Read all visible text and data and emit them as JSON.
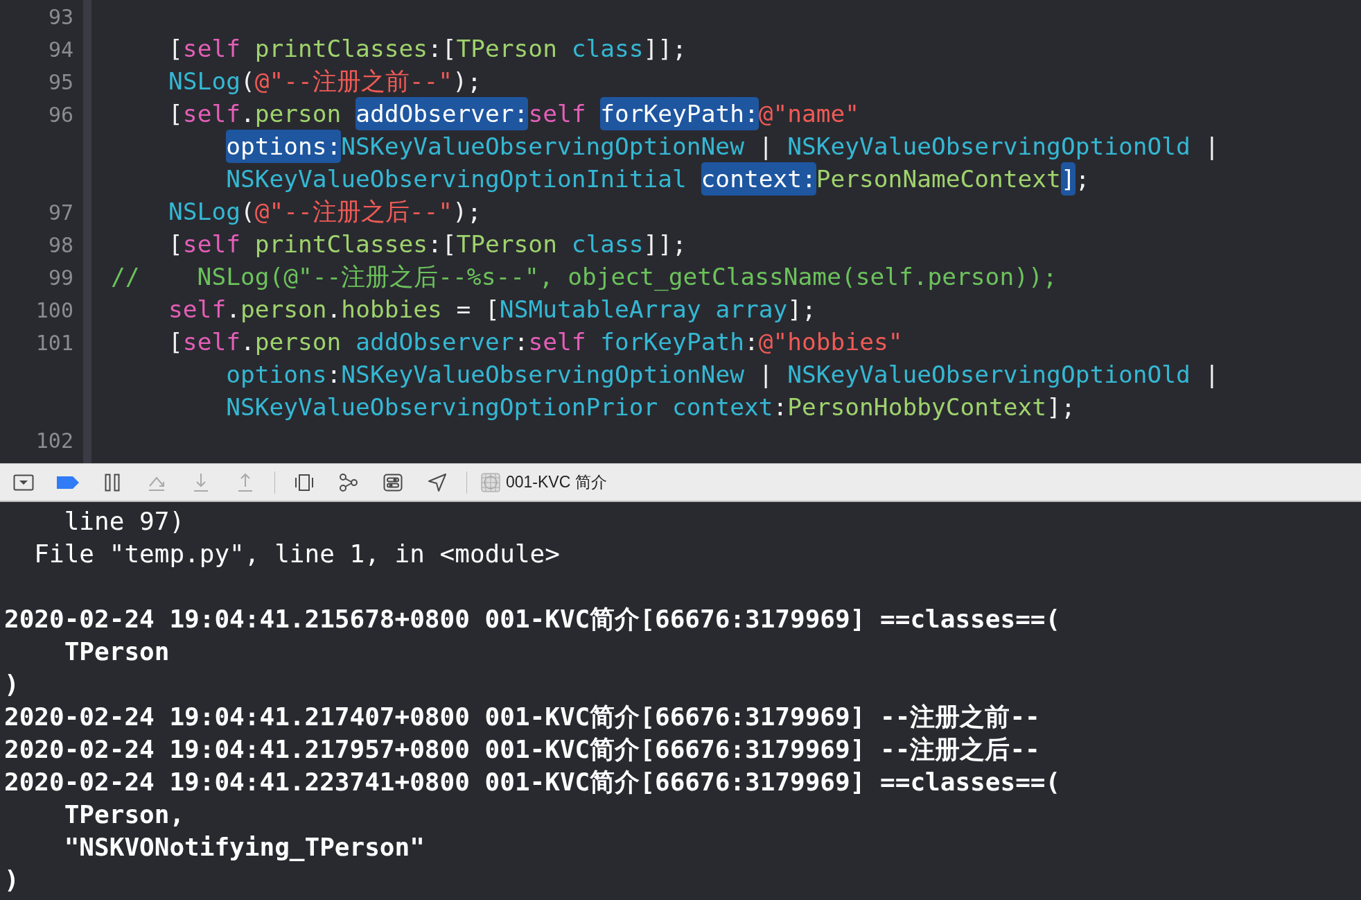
{
  "editor": {
    "lines": [
      {
        "number": "93",
        "kind": "statement"
      },
      {
        "number": "94",
        "kind": "statement",
        "tokens": [
          {
            "text": "[",
            "kind": "plain"
          },
          {
            "text": "self ",
            "kind": "keyword"
          },
          {
            "text": "printClasses",
            "kind": "project"
          },
          {
            "text": ":[",
            "kind": "plain"
          },
          {
            "text": "TPerson ",
            "kind": "project"
          },
          {
            "text": "class",
            "kind": "system"
          },
          {
            "text": "]];",
            "kind": "plain"
          }
        ]
      },
      {
        "number": "95",
        "kind": "statement",
        "tokens": [
          {
            "text": "NSLog",
            "kind": "system"
          },
          {
            "text": "(",
            "kind": "plain"
          },
          {
            "text": "@\"--注册之前--\"",
            "kind": "string"
          },
          {
            "text": ");",
            "kind": "plain"
          }
        ]
      },
      {
        "number": "96",
        "kind": "statement",
        "tokens": [
          {
            "text": "[",
            "kind": "plain"
          },
          {
            "text": "self",
            "kind": "keyword"
          },
          {
            "text": ".",
            "kind": "plain"
          },
          {
            "text": "person ",
            "kind": "project"
          },
          {
            "text": "addObserver:",
            "kind": "highlight"
          },
          {
            "text": "self ",
            "kind": "keyword"
          },
          {
            "text": "forKeyPath:",
            "kind": "highlight"
          },
          {
            "text": "@\"name\"",
            "kind": "string"
          }
        ]
      },
      {
        "kind": "continuation",
        "tokens": [
          {
            "text": "options:",
            "kind": "highlight"
          },
          {
            "text": "NSKeyValueObservingOptionNew",
            "kind": "system"
          },
          {
            "text": " | ",
            "kind": "plain"
          },
          {
            "text": "NSKeyValueObservingOptionOld",
            "kind": "system"
          },
          {
            "text": " |",
            "kind": "plain"
          }
        ]
      },
      {
        "kind": "continuation",
        "tokens": [
          {
            "text": "NSKeyValueObservingOptionInitial ",
            "kind": "system"
          },
          {
            "text": "context:",
            "kind": "highlight"
          },
          {
            "text": "PersonNameContext",
            "kind": "project"
          },
          {
            "text": "]",
            "kind": "highlight"
          },
          {
            "text": ";",
            "kind": "plain"
          }
        ]
      },
      {
        "number": "97",
        "kind": "statement",
        "tokens": [
          {
            "text": "NSLog",
            "kind": "system"
          },
          {
            "text": "(",
            "kind": "plain"
          },
          {
            "text": "@\"--注册之后--\"",
            "kind": "string"
          },
          {
            "text": ");",
            "kind": "plain"
          }
        ]
      },
      {
        "number": "98",
        "kind": "statement",
        "tokens": [
          {
            "text": "[",
            "kind": "plain"
          },
          {
            "text": "self ",
            "kind": "keyword"
          },
          {
            "text": "printClasses",
            "kind": "project"
          },
          {
            "text": ":[",
            "kind": "plain"
          },
          {
            "text": "TPerson ",
            "kind": "project"
          },
          {
            "text": "class",
            "kind": "system"
          },
          {
            "text": "]];",
            "kind": "plain"
          }
        ]
      },
      {
        "number": "99",
        "kind": "comment",
        "tokens": [
          {
            "text": "//    NSLog(@\"--注册之后--%s--\", object_getClassName(self.person));",
            "kind": "comment"
          }
        ]
      },
      {
        "number": "100",
        "kind": "statement",
        "tokens": [
          {
            "text": "self",
            "kind": "keyword"
          },
          {
            "text": ".",
            "kind": "plain"
          },
          {
            "text": "person",
            "kind": "project"
          },
          {
            "text": ".",
            "kind": "plain"
          },
          {
            "text": "hobbies",
            "kind": "project"
          },
          {
            "text": " = [",
            "kind": "plain"
          },
          {
            "text": "NSMutableArray ",
            "kind": "system"
          },
          {
            "text": "array",
            "kind": "system"
          },
          {
            "text": "];",
            "kind": "plain"
          }
        ]
      },
      {
        "number": "101",
        "kind": "statement",
        "tokens": [
          {
            "text": "[",
            "kind": "plain"
          },
          {
            "text": "self",
            "kind": "keyword"
          },
          {
            "text": ".",
            "kind": "plain"
          },
          {
            "text": "person ",
            "kind": "project"
          },
          {
            "text": "addObserver",
            "kind": "system"
          },
          {
            "text": ":",
            "kind": "plain"
          },
          {
            "text": "self ",
            "kind": "keyword"
          },
          {
            "text": "forKeyPath",
            "kind": "system"
          },
          {
            "text": ":",
            "kind": "plain"
          },
          {
            "text": "@\"hobbies\"",
            "kind": "string"
          }
        ]
      },
      {
        "kind": "continuation",
        "tokens": [
          {
            "text": "options",
            "kind": "system"
          },
          {
            "text": ":",
            "kind": "plain"
          },
          {
            "text": "NSKeyValueObservingOptionNew",
            "kind": "system"
          },
          {
            "text": " | ",
            "kind": "plain"
          },
          {
            "text": "NSKeyValueObservingOptionOld",
            "kind": "system"
          },
          {
            "text": " |",
            "kind": "plain"
          }
        ]
      },
      {
        "kind": "continuation",
        "tokens": [
          {
            "text": "NSKeyValueObservingOptionPrior ",
            "kind": "system"
          },
          {
            "text": "context",
            "kind": "system"
          },
          {
            "text": ":",
            "kind": "plain"
          },
          {
            "text": "PersonHobbyContext",
            "kind": "project"
          },
          {
            "text": "];",
            "kind": "plain"
          }
        ]
      },
      {
        "number": "102",
        "kind": "statement"
      }
    ]
  },
  "debug_bar": {
    "buttons": [
      {
        "kind": "toggle_panel",
        "disabled": false
      },
      {
        "kind": "breakpoints",
        "disabled": false,
        "on": true
      },
      {
        "kind": "pause",
        "disabled": false
      },
      {
        "kind": "step_over",
        "disabled": true
      },
      {
        "kind": "step_into",
        "disabled": true
      },
      {
        "kind": "step_out",
        "disabled": true
      },
      {
        "kind": "view_hierarchy",
        "disabled": false
      },
      {
        "kind": "memory_graph",
        "disabled": false
      },
      {
        "kind": "environment",
        "disabled": false
      },
      {
        "kind": "location",
        "disabled": false
      }
    ],
    "target": "001-KVC 简介"
  },
  "console": {
    "lines": [
      {
        "kind": "trace",
        "text": "    line 97)"
      },
      {
        "kind": "trace",
        "text": "  File \"temp.py\", line 1, in <module>"
      },
      {
        "kind": "blank"
      },
      {
        "kind": "log",
        "text": "2020-02-24 19:04:41.215678+0800 001-KVC简介[66676:3179969] ==classes==("
      },
      {
        "kind": "log",
        "text": "    TPerson"
      },
      {
        "kind": "log",
        "text": ")"
      },
      {
        "kind": "log",
        "text": "2020-02-24 19:04:41.217407+0800 001-KVC简介[66676:3179969] --注册之前--"
      },
      {
        "kind": "log",
        "text": "2020-02-24 19:04:41.217957+0800 001-KVC简介[66676:3179969] --注册之后--"
      },
      {
        "kind": "log",
        "text": "2020-02-24 19:04:41.223741+0800 001-KVC简介[66676:3179969] ==classes==("
      },
      {
        "kind": "log",
        "text": "    TPerson,"
      },
      {
        "kind": "log",
        "text": "    \"NSKVONotifying_TPerson\""
      },
      {
        "kind": "log",
        "text": ")"
      }
    ]
  }
}
